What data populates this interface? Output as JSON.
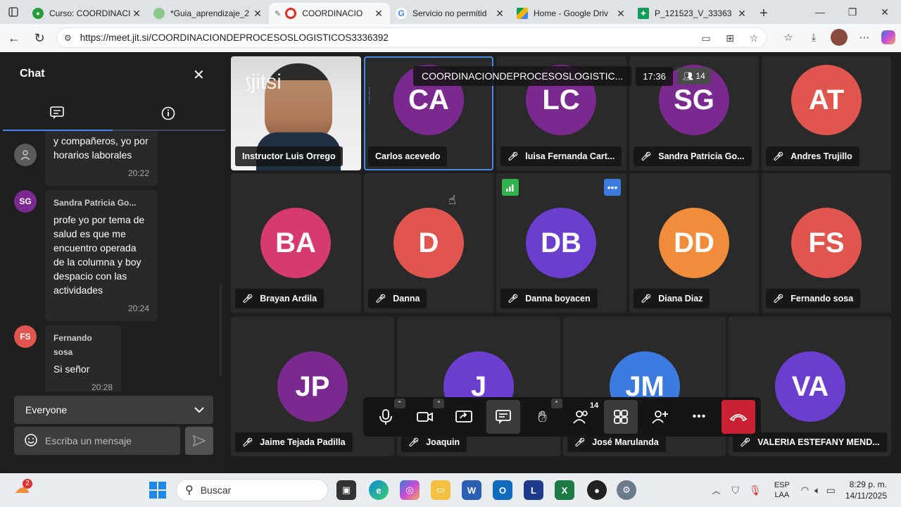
{
  "browser": {
    "tabs": [
      {
        "title": "Curso: COORDINACI",
        "favicon_color": "#2a9d3a"
      },
      {
        "title": "*Guia_aprendizaje_2",
        "favicon_color": "#8ac98a"
      },
      {
        "title": "COORDINACIO",
        "favicon_color": "#d93025"
      },
      {
        "title": "Servicio no permitid",
        "favicon_color": "#4285f4"
      },
      {
        "title": "Home - Google Driv",
        "favicon_color": "#f4b400"
      },
      {
        "title": "P_121523_V_33363",
        "favicon_color": "#0f9d58"
      }
    ],
    "url": "https://meet.jit.si/COORDINACIONDEPROCESOSLOGISTICOS3336392"
  },
  "chat": {
    "title": "Chat",
    "messages": [
      {
        "initials": "",
        "avatar_color": "#5a5a5a",
        "name": "",
        "lines": [
          "y compañeros, yo por",
          "horarios laborales"
        ],
        "time": "20:22"
      },
      {
        "initials": "SG",
        "avatar_color": "#7a2a8e",
        "name": "Sandra Patricia Go...",
        "lines": [
          "profe yo por tema de",
          "salud es que me",
          "encuentro operada",
          "de la columna y boy",
          "despacio con las",
          "actividades"
        ],
        "time": "20:24"
      },
      {
        "initials": "FS",
        "avatar_color": "#e0554d",
        "name": "Fernando sosa",
        "lines": [
          "Si señor"
        ],
        "time": "20:28"
      }
    ],
    "recipient": "Everyone",
    "input_placeholder": "Escriba un mensaje"
  },
  "meeting": {
    "name": "COORDINACIONDEPROCESOSLOGISTIC...",
    "time": "17:36",
    "participant_count": "14",
    "watermark": "jitsi"
  },
  "participants": [
    {
      "initials": "",
      "name": "Instructor Luis Orrego",
      "color": "",
      "muted": false
    },
    {
      "initials": "CA",
      "name": "Carlos acevedo",
      "color": "#7a2a8e",
      "muted": false
    },
    {
      "initials": "LC",
      "name": "luisa Fernanda Cart...",
      "color": "#7a2a8e",
      "muted": true
    },
    {
      "initials": "SG",
      "name": "Sandra Patricia Go...",
      "color": "#7a2a8e",
      "muted": true
    },
    {
      "initials": "AT",
      "name": "Andres Trujillo",
      "color": "#e0554d",
      "muted": true
    },
    {
      "initials": "BA",
      "name": "Brayan Ardila",
      "color": "#d63b6f",
      "muted": true
    },
    {
      "initials": "D",
      "name": "Danna",
      "color": "#e0554d",
      "muted": true
    },
    {
      "initials": "DB",
      "name": "Danna boyacen",
      "color": "#6a3fcf",
      "muted": true
    },
    {
      "initials": "DD",
      "name": "Diana Diaz",
      "color": "#f08c3a",
      "muted": true
    },
    {
      "initials": "FS",
      "name": "Fernando sosa",
      "color": "#e0554d",
      "muted": true
    },
    {
      "initials": "JP",
      "name": "Jaime Tejada Padilla",
      "color": "#7a2a8e",
      "muted": true
    },
    {
      "initials": "J",
      "name": "Joaquin",
      "color": "#6a3fcf",
      "muted": true
    },
    {
      "initials": "JM",
      "name": "José Marulanda",
      "color": "#3b7be0",
      "muted": true
    },
    {
      "initials": "VA",
      "name": "VALERIA ESTEFANY MEND...",
      "color": "#6a3fcf",
      "muted": true
    }
  ],
  "toolbar": {
    "participants_badge": "14"
  },
  "taskbar": {
    "search_placeholder": "Buscar",
    "widget_badge": "2",
    "lang_line1": "ESP",
    "lang_line2": "LAA",
    "time": "8:29 p. m.",
    "date": "14/11/2025"
  }
}
